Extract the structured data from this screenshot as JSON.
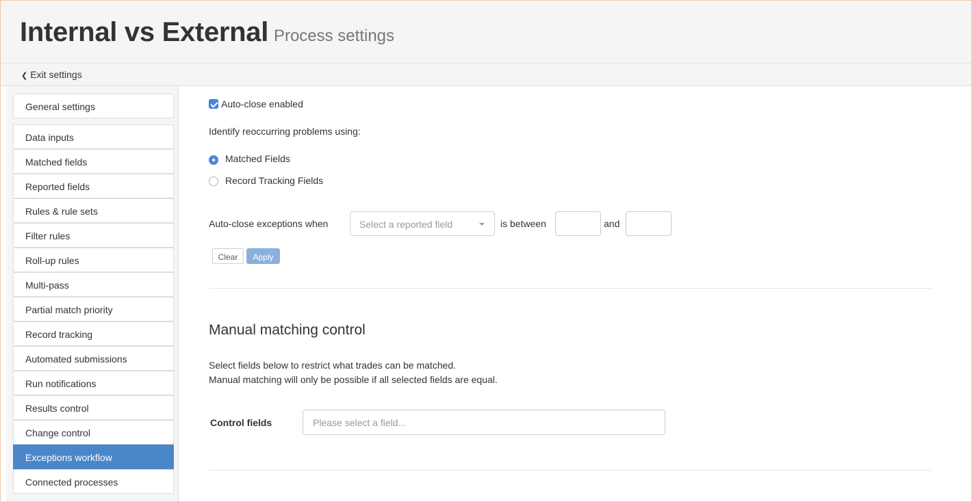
{
  "header": {
    "title": "Internal vs External",
    "subtitle": "Process settings",
    "exit_label": "Exit settings"
  },
  "sidebar": {
    "items": [
      {
        "label": "General settings",
        "active": false
      },
      {
        "label": "Data inputs",
        "active": false
      },
      {
        "label": "Matched fields",
        "active": false
      },
      {
        "label": "Reported fields",
        "active": false
      },
      {
        "label": "Rules & rule sets",
        "active": false
      },
      {
        "label": "Filter rules",
        "active": false
      },
      {
        "label": "Roll-up rules",
        "active": false
      },
      {
        "label": "Multi-pass",
        "active": false
      },
      {
        "label": "Partial match priority",
        "active": false
      },
      {
        "label": "Record tracking",
        "active": false
      },
      {
        "label": "Automated submissions",
        "active": false
      },
      {
        "label": "Run notifications",
        "active": false
      },
      {
        "label": "Results control",
        "active": false
      },
      {
        "label": "Change control",
        "active": false
      },
      {
        "label": "Exceptions workflow",
        "active": true
      },
      {
        "label": "Connected processes",
        "active": false
      }
    ]
  },
  "autoclose": {
    "checkbox_label": "Auto-close enabled",
    "checked": true,
    "identify_label": "Identify reoccurring problems using:",
    "radio_matched": "Matched Fields",
    "radio_tracking": "Record Tracking Fields",
    "selected": "Matched Fields",
    "when_label": "Auto-close exceptions when",
    "field_placeholder": "Select a reported field",
    "between_label": "is between",
    "and_label": "and",
    "min_value": "",
    "max_value": "",
    "clear_label": "Clear",
    "apply_label": "Apply"
  },
  "manual": {
    "title": "Manual matching control",
    "desc_line1": "Select fields below to restrict what trades can be matched.",
    "desc_line2": "Manual matching will only be possible if all selected fields are equal.",
    "control_label": "Control fields",
    "control_placeholder": "Please select a field..."
  },
  "colors": {
    "accent": "#4a86c8",
    "apply_button": "#8bb0dd",
    "frame_border": "#f0c8a4"
  }
}
